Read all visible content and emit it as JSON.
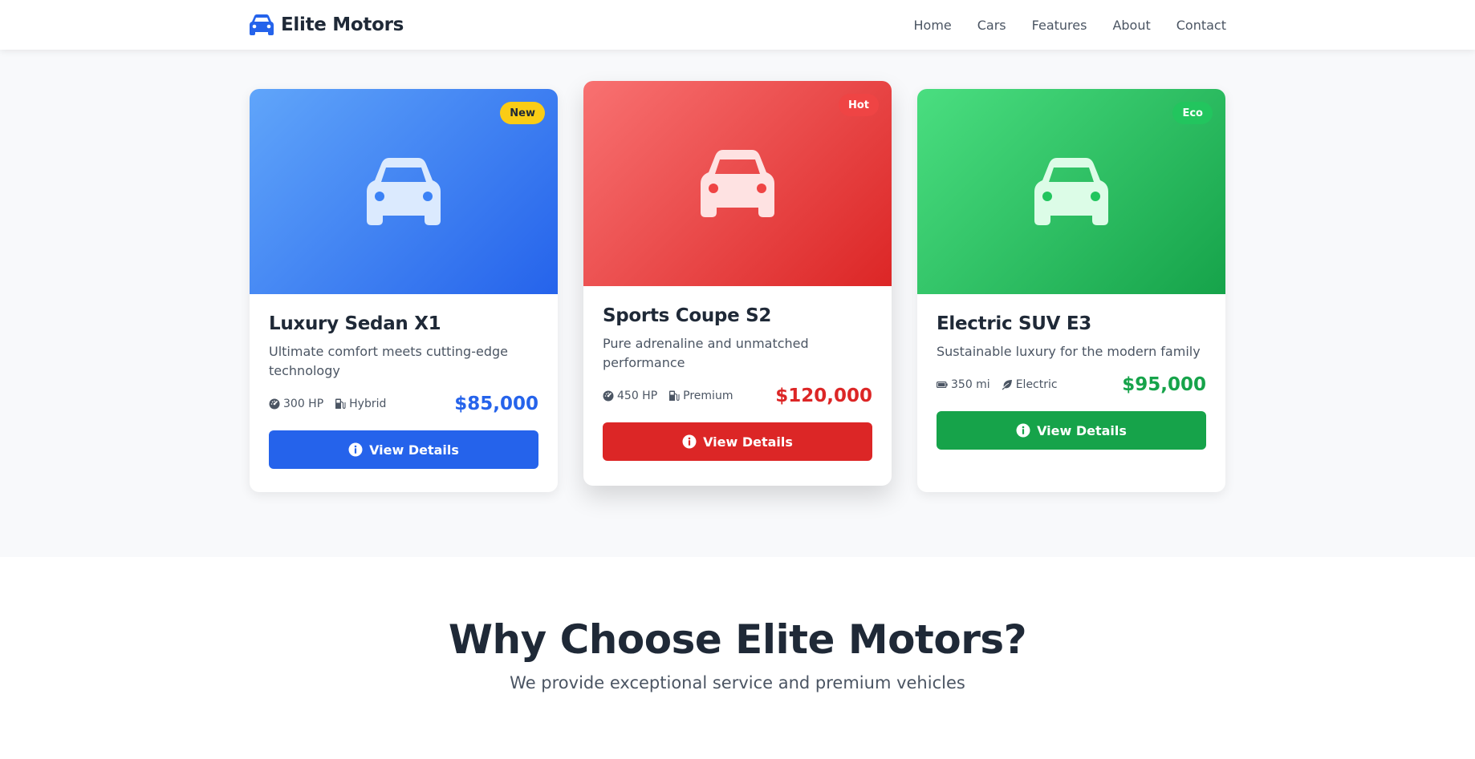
{
  "navbar": {
    "brand": "Elite Motors",
    "brand_icon": "car-icon",
    "links": [
      "Home",
      "Cars",
      "Features",
      "About",
      "Contact"
    ]
  },
  "cars": [
    {
      "badge": "New",
      "title": "Luxury Sedan X1",
      "description": "Ultimate comfort meets cutting-edge technology",
      "spec1": "300 HP",
      "spec1_icon": "speedometer-icon",
      "spec2": "Hybrid",
      "spec2_icon": "fuel-pump-icon",
      "price": "$85,000",
      "button": "View Details",
      "accent": "#2563eb"
    },
    {
      "badge": "Hot",
      "title": "Sports Coupe S2",
      "description": "Pure adrenaline and unmatched performance",
      "spec1": "450 HP",
      "spec1_icon": "speedometer-icon",
      "spec2": "Premium",
      "spec2_icon": "fuel-pump-icon",
      "price": "$120,000",
      "button": "View Details",
      "accent": "#dc2626"
    },
    {
      "badge": "Eco",
      "title": "Electric SUV E3",
      "description": "Sustainable luxury for the modern family",
      "spec1": "350 mi",
      "spec1_icon": "battery-icon",
      "spec2": "Electric",
      "spec2_icon": "leaf-icon",
      "price": "$95,000",
      "button": "View Details",
      "accent": "#16a34a"
    }
  ],
  "features": {
    "title": "Why Choose Elite Motors?",
    "subtitle": "We provide exceptional service and premium vehicles"
  }
}
